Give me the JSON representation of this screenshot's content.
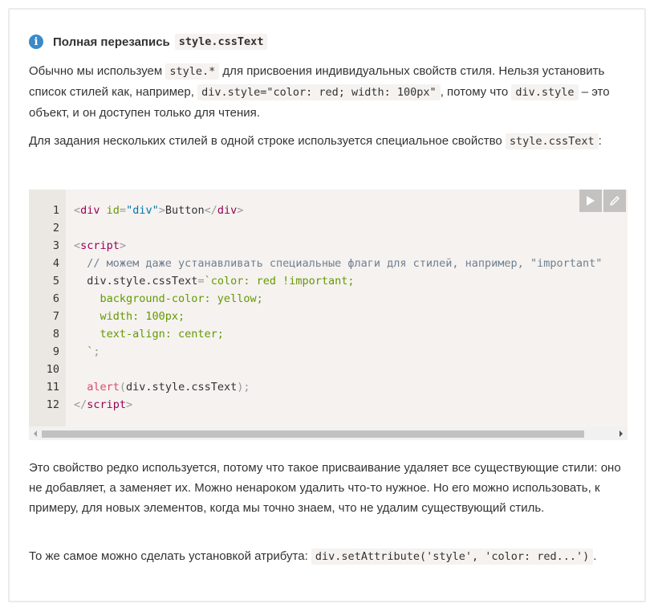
{
  "header": {
    "icon": "info-icon",
    "title": "Полная перезапись",
    "code": "style.cssText"
  },
  "para1": {
    "t1": "Обычно мы используем ",
    "c1": "style.*",
    "t2": " для присвоения индивидуальных свойств стиля. Нельзя установить список стилей как, например, ",
    "c2": "div.style=\"color: red; width: 100px\"",
    "t3": ", потому что ",
    "c3": "div.style",
    "t4": " – это объект, и он доступен только для чтения."
  },
  "para2": {
    "t1": "Для задания нескольких стилей в одной строке используется специальное свойство ",
    "c1": "style.cssText",
    "t2": ":"
  },
  "code": {
    "line_numbers": [
      "1",
      "2",
      "3",
      "4",
      "5",
      "6",
      "7",
      "8",
      "9",
      "10",
      "11",
      "12"
    ],
    "l1": {
      "a": "<",
      "b": "div",
      "c": " id",
      "d": "=",
      "e": "\"div\"",
      "f": ">",
      "g": "Button",
      "h": "</",
      "i": "div",
      "j": ">"
    },
    "l3": {
      "a": "<",
      "b": "script",
      "c": ">"
    },
    "l4": "  // можем даже устанавливать специальные флаги для стилей, например, \"important\"",
    "l5": {
      "a": "  div.style.cssText",
      "b": "=",
      "c": "`color: red !important;"
    },
    "l6": "    background-color: yellow;",
    "l7": "    width: 100px;",
    "l8": "    text-align: center;",
    "l9": {
      "a": "  `",
      "b": ";"
    },
    "l11": {
      "a": "  ",
      "b": "alert",
      "c": "(",
      "d": "div.style.cssText",
      "e": ")",
      "f": ";"
    },
    "l12": {
      "a": "</",
      "b": "script",
      "c": ">"
    },
    "run_icon": "play-icon",
    "edit_icon": "pencil-icon"
  },
  "para3": "Это свойство редко используется, потому что такое присваивание удаляет все существующие стили: оно не добавляет, а заменяет их. Можно ненароком удалить что-то нужное. Но его можно использовать, к примеру, для новых элементов, когда мы точно знаем, что не удалим существующий стиль.",
  "para4": {
    "t1": "То же самое можно сделать установкой атрибута: ",
    "c1": "div.setAttribute('style', 'color: red...')",
    "t2": "."
  }
}
